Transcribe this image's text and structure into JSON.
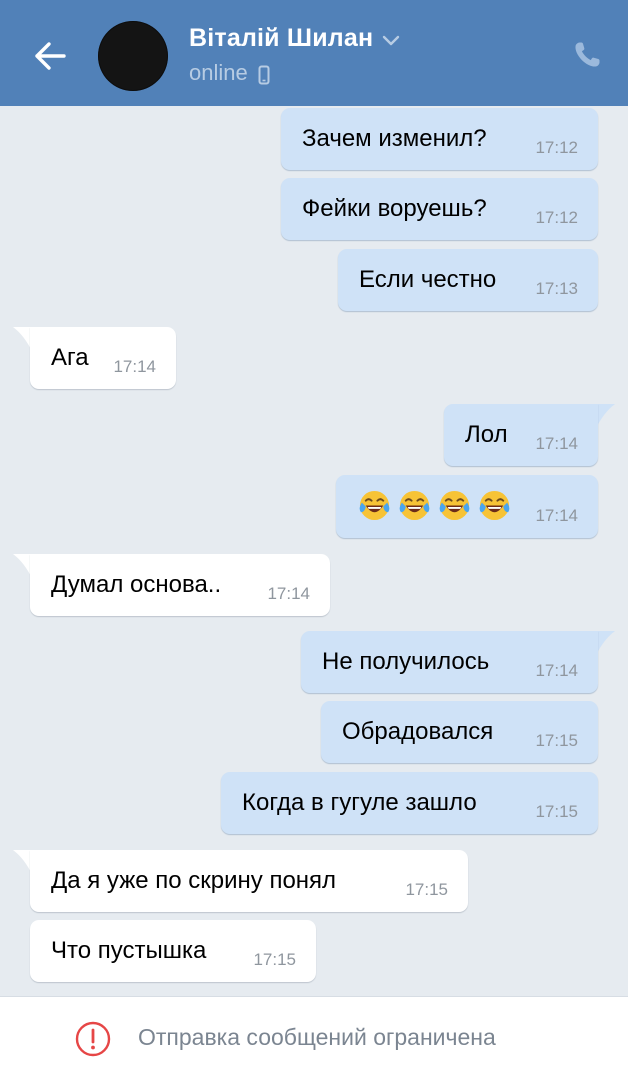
{
  "header": {
    "contact_name": "Віталій Шилан",
    "status": "online",
    "icons": {
      "back": "arrow-left-icon",
      "avatar": "avatar",
      "chevron": "chevron-down-icon",
      "device": "mobile-phone-icon",
      "call": "phone-call-icon"
    },
    "colors": {
      "header_bg": "#5181b8",
      "status_text": "#b7cce3"
    }
  },
  "messages": [
    {
      "direction": "out",
      "text": "Зачем изменил?",
      "time": "17:12"
    },
    {
      "direction": "out",
      "text": "Фейки воруешь?",
      "time": "17:12"
    },
    {
      "direction": "out",
      "text": "Если честно",
      "time": "17:13"
    },
    {
      "direction": "in",
      "text": "Ага",
      "time": "17:14"
    },
    {
      "direction": "out",
      "text": "Лол",
      "time": "17:14"
    },
    {
      "direction": "out",
      "text": "😂😂😂😂",
      "time": "17:14",
      "emoji": [
        "face-with-tears-of-joy",
        "face-with-tears-of-joy",
        "face-with-tears-of-joy",
        "face-with-tears-of-joy"
      ]
    },
    {
      "direction": "in",
      "text": "Думал основа..",
      "time": "17:14"
    },
    {
      "direction": "out",
      "text": "Не получилось",
      "time": "17:14"
    },
    {
      "direction": "out",
      "text": "Обрадовался",
      "time": "17:15"
    },
    {
      "direction": "out",
      "text": "Когда в гугуле зашло",
      "time": "17:15"
    },
    {
      "direction": "in",
      "text": "Да я уже по скрину понял",
      "time": "17:15"
    },
    {
      "direction": "in",
      "text": "Что пустышка",
      "time": "17:15"
    }
  ],
  "footer": {
    "notice": "Отправка сообщений ограничена",
    "icon": "warning-circle-icon"
  },
  "colors": {
    "chat_bg": "#e6ebf0",
    "outgoing_bubble": "#cfe2f7",
    "incoming_bubble": "#ffffff",
    "time_text": "#8f969e",
    "warning_red": "#e64646"
  }
}
